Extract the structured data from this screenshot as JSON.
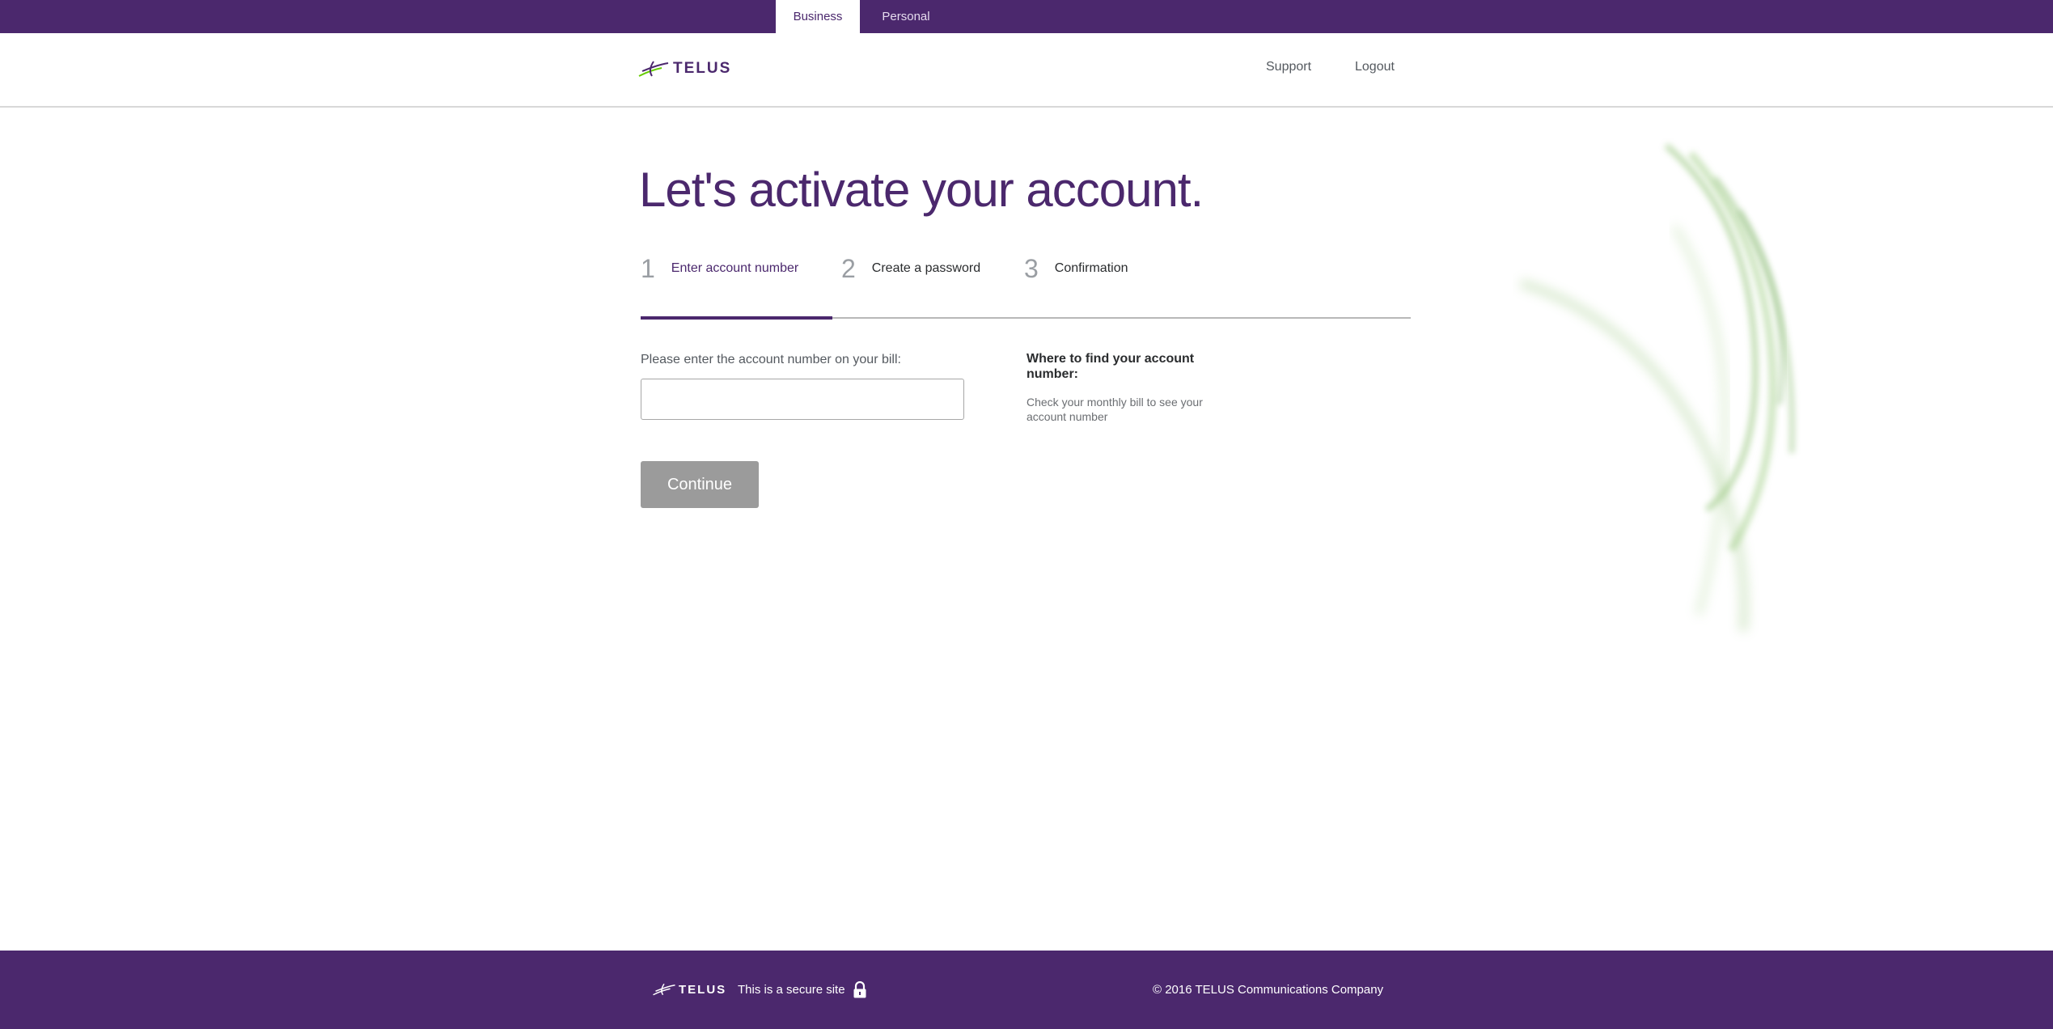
{
  "top_tabs": {
    "business": "Business",
    "personal": "Personal"
  },
  "header": {
    "logo_text": "TELUS",
    "support": "Support",
    "logout": "Logout"
  },
  "main": {
    "title": "Let's activate your account.",
    "steps": [
      {
        "number": "1",
        "label": "Enter account number"
      },
      {
        "number": "2",
        "label": "Create a password"
      },
      {
        "number": "3",
        "label": "Confirmation"
      }
    ],
    "current_step": 1,
    "field_label": "Please enter the account number on your bill:",
    "account_input_value": "",
    "continue_label": "Continue",
    "help_title": "Where to find your account number:",
    "help_text": "Check your monthly bill to see your account number"
  },
  "footer": {
    "logo_text": "TELUS",
    "secure_text": "This is a secure site",
    "copyright": "© 2016 TELUS Communications Company"
  },
  "colors": {
    "brand_purple": "#4b286d",
    "button_disabled": "#9b9b9b",
    "logo_green": "#66cc00"
  },
  "icons": {
    "lock": "lock-icon",
    "logo_mark": "telus-logo-mark-icon"
  }
}
